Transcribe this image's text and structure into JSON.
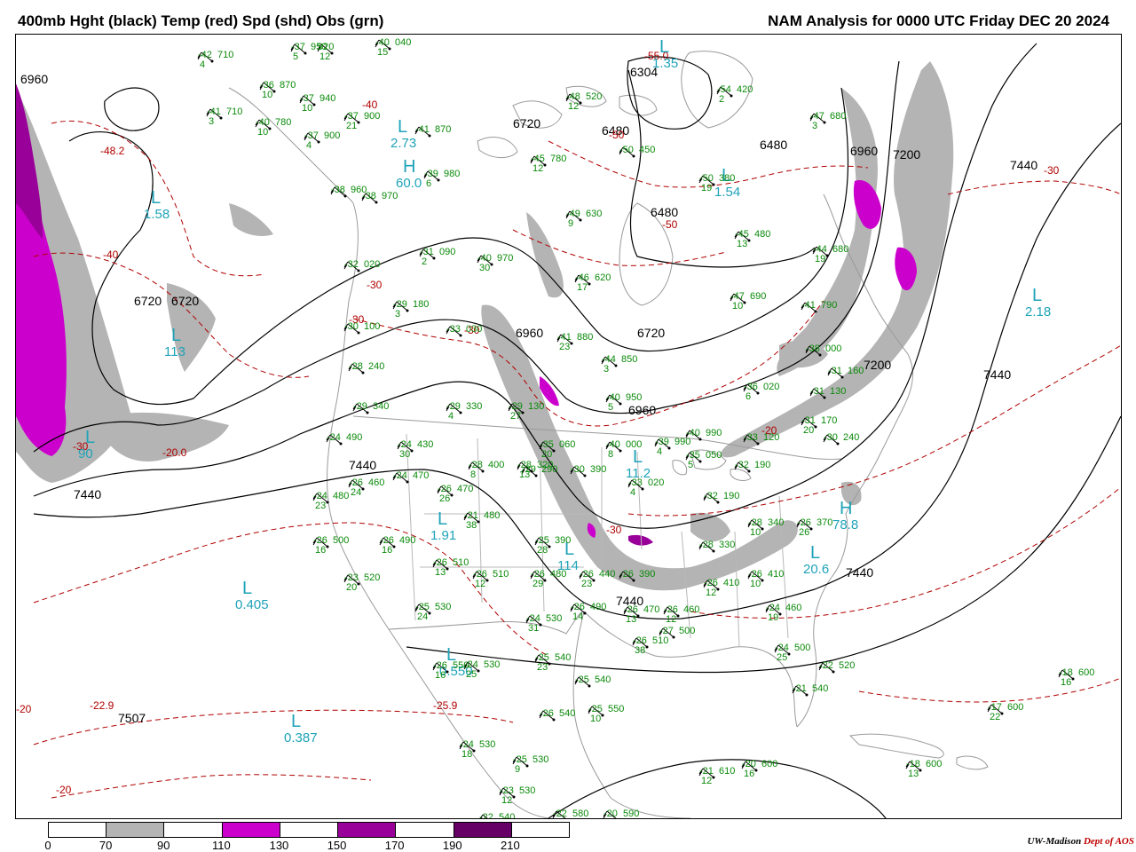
{
  "header": {
    "left_title": "400mb Hght (black) Temp (red) Spd (shd) Obs (grn)",
    "right_title": "NAM Analysis for 0000 UTC Friday  DEC 20 2024"
  },
  "colors": {
    "height_contour": "#000000",
    "temp_contour": "#b00000",
    "obs": "#0a8a0a",
    "systems": "#1fa3b8",
    "geography": "#9a9a9a"
  },
  "height_labels": [
    "6960",
    "6720",
    "6720",
    "6480",
    "6720",
    "6480",
    "6480",
    "6304",
    "6720",
    "6960",
    "7200",
    "7440",
    "6960",
    "6960",
    "7200",
    "7440",
    "7440",
    "7440",
    "7440",
    "7507",
    "7440"
  ],
  "temp_labels": [
    "-48.2",
    "-40",
    "-50",
    "-55.0",
    "-50",
    "-40",
    "-30",
    "-30",
    "-30",
    "-20",
    "-30",
    "-20.0",
    "-25.9",
    "-22.9",
    "-20",
    "-20",
    "-30",
    "-30"
  ],
  "systems": [
    {
      "type": "L",
      "value": "1.58"
    },
    {
      "type": "L",
      "value": "2.73"
    },
    {
      "type": "H",
      "value": "60.0"
    },
    {
      "type": "L",
      "value": "1.35"
    },
    {
      "type": "L",
      "value": "1.54"
    },
    {
      "type": "L",
      "value": "2.18"
    },
    {
      "type": "L",
      "value": "1.91"
    },
    {
      "type": "L",
      "value": "0.405"
    },
    {
      "type": "L",
      "value": "0.550"
    },
    {
      "type": "L",
      "value": "0.387"
    },
    {
      "type": "H",
      "value": "78.8"
    },
    {
      "type": "L",
      "value": "20.6"
    },
    {
      "type": "L",
      "value": "11.2"
    },
    {
      "type": "L",
      "value": "114"
    },
    {
      "type": "L",
      "value": "113"
    },
    {
      "type": "L",
      "value": "90"
    }
  ],
  "observations": [
    {
      "t": "-42",
      "h": "710",
      "d": "4"
    },
    {
      "t": "-37",
      "h": "950",
      "d": "5"
    },
    {
      "t": "920",
      "h": "",
      "d": "12"
    },
    {
      "t": "-40",
      "h": "040",
      "d": "15"
    },
    {
      "t": "-41",
      "h": "710",
      "d": "3"
    },
    {
      "t": "-36",
      "h": "870",
      "d": "10"
    },
    {
      "t": "-37",
      "h": "940",
      "d": "10"
    },
    {
      "t": "-37",
      "h": "900",
      "d": "21"
    },
    {
      "t": "-40",
      "h": "780",
      "d": "10"
    },
    {
      "t": "-37",
      "h": "900",
      "d": "4"
    },
    {
      "t": "-41",
      "h": "870",
      "d": ""
    },
    {
      "t": "-48",
      "h": "520",
      "d": "12"
    },
    {
      "t": "-45",
      "h": "780",
      "d": "12"
    },
    {
      "t": "-50",
      "h": "450",
      "d": ""
    },
    {
      "t": "-54",
      "h": "420",
      "d": "2"
    },
    {
      "t": "-47",
      "h": "680",
      "d": "3"
    },
    {
      "t": "-50",
      "h": "380",
      "d": "19"
    },
    {
      "t": "-38",
      "h": "960",
      "d": ""
    },
    {
      "t": "-38",
      "h": "970",
      "d": ""
    },
    {
      "t": "-39",
      "h": "980",
      "d": "6"
    },
    {
      "t": "-49",
      "h": "630",
      "d": "9"
    },
    {
      "t": "-45",
      "h": "480",
      "d": "13"
    },
    {
      "t": "-44",
      "h": "680",
      "d": "19"
    },
    {
      "t": "-31",
      "h": "090",
      "d": "2"
    },
    {
      "t": "-40",
      "h": "970",
      "d": "30"
    },
    {
      "t": "-32",
      "h": "020",
      "d": ""
    },
    {
      "t": "-46",
      "h": "620",
      "d": "17"
    },
    {
      "t": "-47",
      "h": "690",
      "d": "10"
    },
    {
      "t": "-41",
      "h": "790",
      "d": ""
    },
    {
      "t": "-29",
      "h": "180",
      "d": "3"
    },
    {
      "t": "-30",
      "h": "100",
      "d": ""
    },
    {
      "t": "-33",
      "h": "030",
      "d": ""
    },
    {
      "t": "-41",
      "h": "880",
      "d": "23"
    },
    {
      "t": "-44",
      "h": "850",
      "d": "3"
    },
    {
      "t": "-38",
      "h": "000",
      "d": ""
    },
    {
      "t": "-28",
      "h": "240",
      "d": ""
    },
    {
      "t": "-36",
      "h": "020",
      "d": "6"
    },
    {
      "t": "-31",
      "h": "130",
      "d": ""
    },
    {
      "t": "-31",
      "h": "160",
      "d": ""
    },
    {
      "t": "-29",
      "h": "340",
      "d": ""
    },
    {
      "t": "-29",
      "h": "330",
      "d": "4"
    },
    {
      "t": "-29",
      "h": "130",
      "d": "27"
    },
    {
      "t": "-40",
      "h": "950",
      "d": "5"
    },
    {
      "t": "-31",
      "h": "170",
      "d": "20"
    },
    {
      "t": "-24",
      "h": "490",
      "d": ""
    },
    {
      "t": "-24",
      "h": "430",
      "d": "30"
    },
    {
      "t": "-35",
      "h": "060",
      "d": "20"
    },
    {
      "t": "-40",
      "h": "000",
      "d": "8"
    },
    {
      "t": "-39",
      "h": "990",
      "d": "4"
    },
    {
      "t": "-40",
      "h": "990",
      "d": ""
    },
    {
      "t": "-33",
      "h": "120",
      "d": ""
    },
    {
      "t": "-30",
      "h": "240",
      "d": ""
    },
    {
      "t": "-26",
      "h": "460",
      "d": "24"
    },
    {
      "t": "-24",
      "h": "470",
      "d": ""
    },
    {
      "t": "-26",
      "h": "470",
      "d": "26"
    },
    {
      "t": "-28",
      "h": "400",
      "d": "8"
    },
    {
      "t": "-35",
      "h": "050",
      "d": "5"
    },
    {
      "t": "-32",
      "h": "190",
      "d": ""
    },
    {
      "t": "-24",
      "h": "480",
      "d": "23"
    },
    {
      "t": "-21",
      "h": "480",
      "d": "38"
    },
    {
      "t": "-29",
      "h": "290",
      "d": ""
    },
    {
      "t": "-30",
      "h": "390",
      "d": ""
    },
    {
      "t": "-33",
      "h": "020",
      "d": "4"
    },
    {
      "t": "-32",
      "h": "190",
      "d": ""
    },
    {
      "t": "-28",
      "h": "320",
      "d": "13"
    },
    {
      "t": "-26",
      "h": "500",
      "d": "16"
    },
    {
      "t": "-26",
      "h": "490",
      "d": "16"
    },
    {
      "t": "-25",
      "h": "390",
      "d": "28"
    },
    {
      "t": "-28",
      "h": "330",
      "d": ""
    },
    {
      "t": "-28",
      "h": "340",
      "d": "10"
    },
    {
      "t": "-26",
      "h": "370",
      "d": "26"
    },
    {
      "t": "-23",
      "h": "520",
      "d": "20"
    },
    {
      "t": "-26",
      "h": "510",
      "d": "13"
    },
    {
      "t": "-26",
      "h": "510",
      "d": "12"
    },
    {
      "t": "-26",
      "h": "480",
      "d": "29"
    },
    {
      "t": "-26",
      "h": "440",
      "d": "23"
    },
    {
      "t": "-26",
      "h": "390",
      "d": ""
    },
    {
      "t": "-26",
      "h": "410",
      "d": "12"
    },
    {
      "t": "-26",
      "h": "410",
      "d": "10"
    },
    {
      "t": "-25",
      "h": "530",
      "d": "24"
    },
    {
      "t": "-24",
      "h": "530",
      "d": "31"
    },
    {
      "t": "-26",
      "h": "490",
      "d": "14"
    },
    {
      "t": "-26",
      "h": "470",
      "d": "13"
    },
    {
      "t": "-26",
      "h": "460",
      "d": "12"
    },
    {
      "t": "-24",
      "h": "460",
      "d": "19"
    },
    {
      "t": "-26",
      "h": "510",
      "d": "38"
    },
    {
      "t": "-27",
      "h": "500",
      "d": ""
    },
    {
      "t": "-24",
      "h": "500",
      "d": "25"
    },
    {
      "t": "-26",
      "h": "550",
      "d": "16"
    },
    {
      "t": "-24",
      "h": "530",
      "d": "25"
    },
    {
      "t": "-25",
      "h": "540",
      "d": "23"
    },
    {
      "t": "-22",
      "h": "520",
      "d": ""
    },
    {
      "t": "-21",
      "h": "540",
      "d": ""
    },
    {
      "t": "-25",
      "h": "540",
      "d": ""
    },
    {
      "t": "-26",
      "h": "540",
      "d": ""
    },
    {
      "t": "-25",
      "h": "550",
      "d": "10"
    },
    {
      "t": "-18",
      "h": "600",
      "d": "16"
    },
    {
      "t": "-17",
      "h": "600",
      "d": "22"
    },
    {
      "t": "-24",
      "h": "530",
      "d": "18"
    },
    {
      "t": "-25",
      "h": "530",
      "d": "9"
    },
    {
      "t": "-23",
      "h": "530",
      "d": "12"
    },
    {
      "t": "-21",
      "h": "610",
      "d": "12"
    },
    {
      "t": "-20",
      "h": "600",
      "d": "16"
    },
    {
      "t": "-18",
      "h": "600",
      "d": "13"
    },
    {
      "t": "-22",
      "h": "580",
      "d": ""
    },
    {
      "t": "-20",
      "h": "590",
      "d": ""
    },
    {
      "t": "-22",
      "h": "540",
      "d": ""
    }
  ],
  "legend": {
    "colors": [
      "#ffffff",
      "#b4b4b4",
      "#ffffff",
      "#cc00cc",
      "#ffffff",
      "#990099",
      "#ffffff",
      "#660066",
      "#ffffff"
    ],
    "ticks": [
      "0",
      "70",
      "90",
      "110",
      "130",
      "150",
      "170",
      "190",
      "210"
    ]
  },
  "credit": {
    "org": "UW-Madison",
    "dept": "Dept of AOS"
  }
}
